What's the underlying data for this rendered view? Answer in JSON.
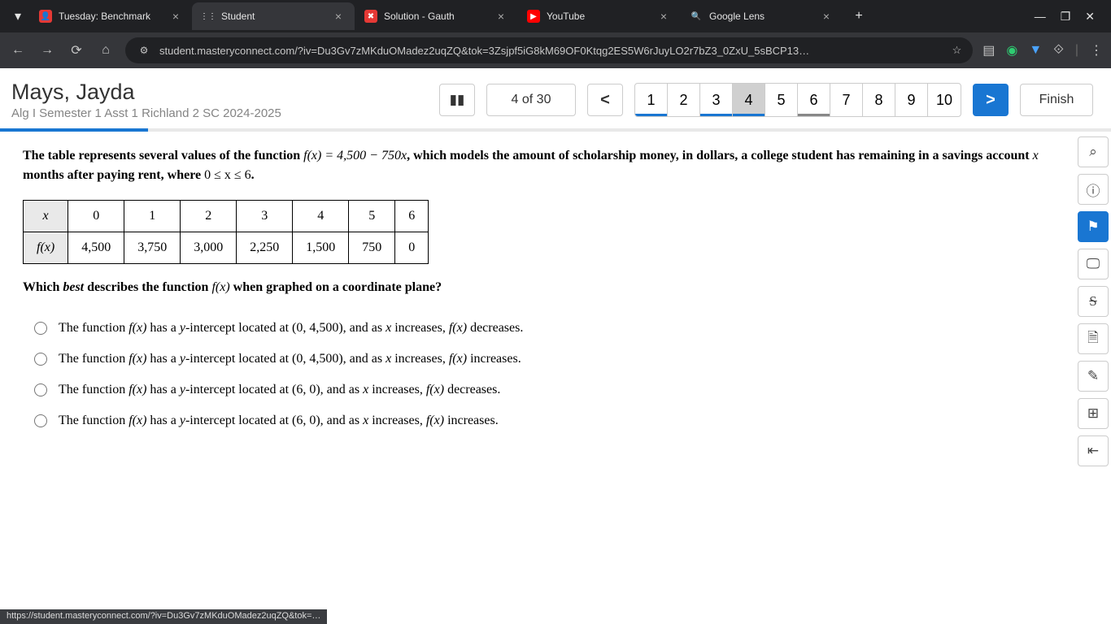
{
  "browser": {
    "tabs": [
      {
        "title": "Tuesday: Benchmark",
        "active": false,
        "favicon_bg": "#e53935",
        "favicon_text": "👤"
      },
      {
        "title": "Student",
        "active": true,
        "favicon_bg": "transparent",
        "favicon_text": "⋮⋮"
      },
      {
        "title": "Solution - Gauth",
        "active": false,
        "favicon_bg": "#e53935",
        "favicon_text": "✖"
      },
      {
        "title": "YouTube",
        "active": false,
        "favicon_bg": "#ff0000",
        "favicon_text": "▶"
      },
      {
        "title": "Google Lens",
        "active": false,
        "favicon_bg": "transparent",
        "favicon_text": "🔍"
      }
    ],
    "url": "student.masteryconnect.com/?iv=Du3Gv7zMKduOMadez2uqZQ&tok=3Zsjpf5iG8kM69OF0Ktqg2ES5W6rJuyLO2r7bZ3_0ZxU_5sBCP13…",
    "status_url": "https://student.masteryconnect.com/?iv=Du3Gv7zMKduOMadez2uqZQ&tok=…"
  },
  "header": {
    "student_name": "Mays, Jayda",
    "assessment": "Alg I Semester 1 Asst 1 Richland 2 SC 2024-2025",
    "counter": "4 of 30",
    "finish": "Finish",
    "questions": [
      {
        "n": "1",
        "state": "answered"
      },
      {
        "n": "2",
        "state": ""
      },
      {
        "n": "3",
        "state": "answered"
      },
      {
        "n": "4",
        "state": "current answered"
      },
      {
        "n": "5",
        "state": ""
      },
      {
        "n": "6",
        "state": "flagged"
      },
      {
        "n": "7",
        "state": ""
      },
      {
        "n": "8",
        "state": ""
      },
      {
        "n": "9",
        "state": ""
      },
      {
        "n": "10",
        "state": ""
      }
    ]
  },
  "question": {
    "intro_a": "The table represents several values of the function ",
    "func": "f(x) = 4,500 − 750x",
    "intro_b": ", which models the amount of scholarship money, in dollars, a college student has remaining in a savings account ",
    "xvar": "x",
    "intro_c": " months after paying rent, where ",
    "domain": "0 ≤ x ≤ 6",
    "intro_d": ".",
    "table": {
      "row1_label": "x",
      "row2_label": "f(x)",
      "cols": [
        "0",
        "1",
        "2",
        "3",
        "4",
        "5",
        "6"
      ],
      "vals": [
        "4,500",
        "3,750",
        "3,000",
        "2,250",
        "1,500",
        "750",
        "0"
      ]
    },
    "sub_a": "Which ",
    "sub_best": "best",
    "sub_b": " describes the function ",
    "sub_fx": "f(x)",
    "sub_c": " when graphed on a coordinate plane?",
    "options": [
      "The function f(x) has a y-intercept located at (0, 4,500), and as x increases, f(x) decreases.",
      "The function f(x) has a y-intercept located at (0, 4,500), and as x increases, f(x) increases.",
      "The function f(x) has a y-intercept located at (6, 0), and as x increases, f(x) decreases.",
      "The function f(x) has a y-intercept located at (6, 0), and as x increases, f(x) increases."
    ]
  },
  "rail": {
    "zoom": "⌕",
    "accessibility": "ⓘ",
    "flag": "⚑",
    "display": "🖵",
    "strike": "S",
    "notes": "🗎",
    "draw": "✎",
    "calc": "⊞",
    "collapse": "⇤"
  }
}
